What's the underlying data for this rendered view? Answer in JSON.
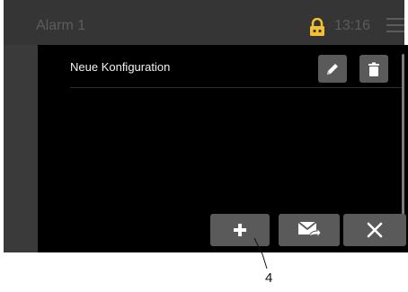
{
  "header": {
    "title": "Alarm 1",
    "time": "13:16",
    "lock_icon": "lock-icon",
    "menu_icon": "menu-icon"
  },
  "list": {
    "items": [
      {
        "label": "Neue Konfiguration",
        "edit_icon": "pencil-icon",
        "delete_icon": "trash-icon"
      }
    ]
  },
  "toolbar": {
    "add_icon": "plus-icon",
    "send_icon": "mail-forward-icon",
    "close_icon": "close-icon"
  },
  "annotation": {
    "callout": "4"
  },
  "colors": {
    "lock": "#f2c230",
    "header_text": "#5c5c5c",
    "button": "#5a5a5a",
    "background": "#000000"
  }
}
